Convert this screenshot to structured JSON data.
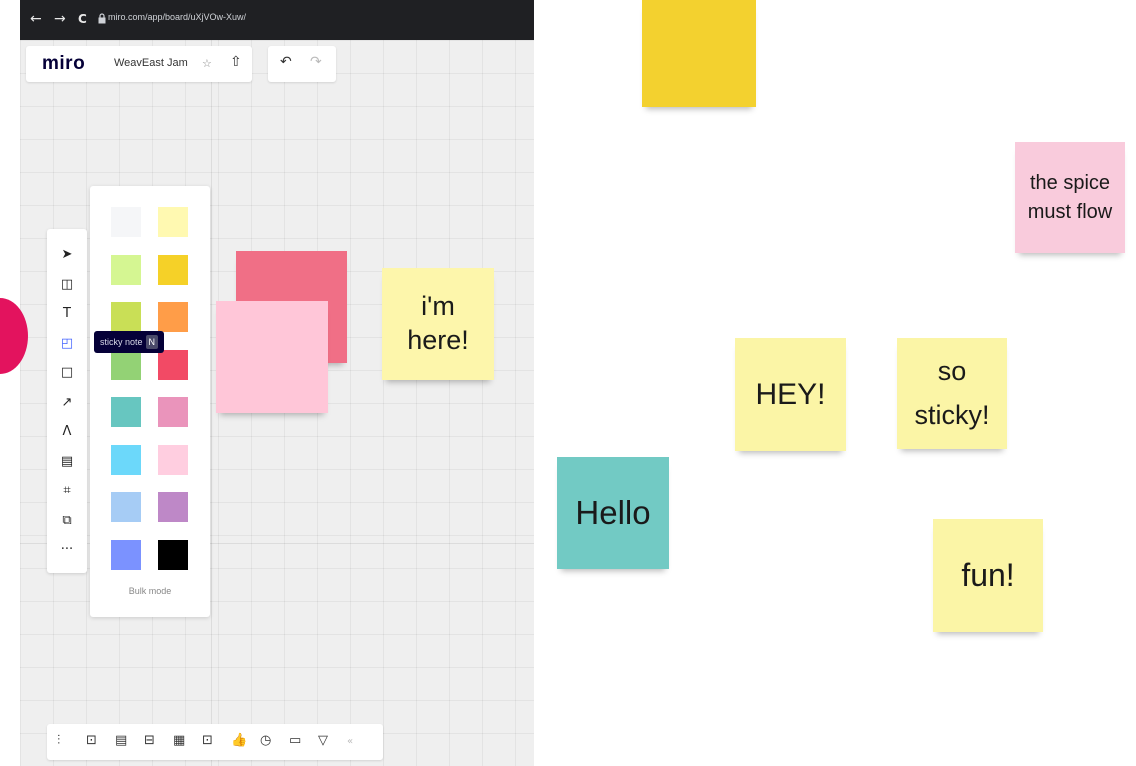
{
  "browser": {
    "nav_back": "←",
    "nav_forward": "→",
    "nav_reload": "C",
    "lock_icon": "lock-icon",
    "url": "miro.com/app/board/uXjVOw-Xuw/"
  },
  "miro": {
    "logo": "miro",
    "board_name": "WeavEast Jam",
    "star": "☆",
    "export": "⇧",
    "undo": "↶",
    "redo": "↷"
  },
  "tools": [
    {
      "name": "select-tool",
      "glyph": "➤"
    },
    {
      "name": "templates-tool",
      "glyph": "◫"
    },
    {
      "name": "text-tool",
      "glyph": "T"
    },
    {
      "name": "sticky-note-tool",
      "glyph": "◰"
    },
    {
      "name": "shape-tool",
      "glyph": "□"
    },
    {
      "name": "connection-line-tool",
      "glyph": "↗"
    },
    {
      "name": "pen-tool",
      "glyph": "Λ"
    },
    {
      "name": "comment-tool",
      "glyph": "▤"
    },
    {
      "name": "frame-tool",
      "glyph": "⌗"
    },
    {
      "name": "upload-tool",
      "glyph": "⧉"
    },
    {
      "name": "more-tools",
      "glyph": "···"
    }
  ],
  "tooltip": {
    "label": "sticky note",
    "key": "N"
  },
  "sticky_colors": [
    "#f5f6f8",
    "#fff9b1",
    "#d5f692",
    "#f5d128",
    "#c9df56",
    "#ff9d48",
    "#93d275",
    "#f24a65",
    "#67c6c0",
    "#ea94bb",
    "#6cd8fa",
    "#ffcee0",
    "#a6ccf5",
    "#be88c7",
    "#7b92ff",
    "#000000"
  ],
  "bulk_mode": "Bulk mode",
  "bottom_tools": [
    "⫶",
    "⊡",
    "▤",
    "⊟",
    "▦",
    "⊡",
    "👍",
    "◷",
    "▭",
    "▽",
    "«"
  ],
  "left_notes": [
    {
      "text": "",
      "color": "#f06f86"
    },
    {
      "text": "",
      "color": "#ffc6d8"
    },
    {
      "text": "i'm here!",
      "color": "#fdf6ab"
    }
  ],
  "right_notes": [
    {
      "text": "",
      "color": "#f3d12f"
    },
    {
      "text": "the spice must flow",
      "color": "#f9cbdc"
    },
    {
      "text": "HEY!",
      "color": "#fbf5a6"
    },
    {
      "text": "so sticky!",
      "color": "#fbf5a6"
    },
    {
      "text": "Hello",
      "color": "#72cac4"
    },
    {
      "text": "fun!",
      "color": "#fbf5a6"
    }
  ]
}
